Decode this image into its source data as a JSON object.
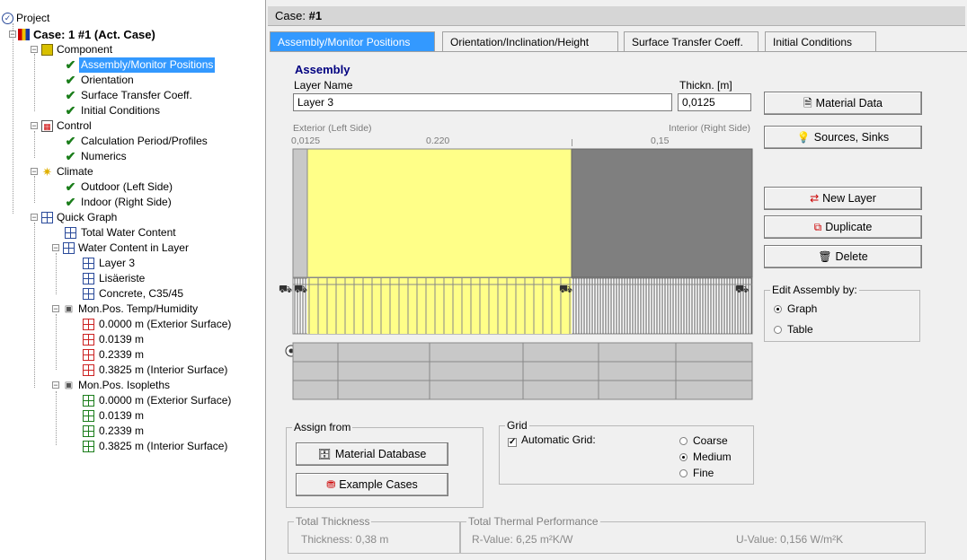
{
  "tree": {
    "project": "Project",
    "case": "Case: 1 #1 (Act. Case)",
    "component": "Component",
    "assembly": "Assembly/Monitor Positions",
    "orientation": "Orientation",
    "surface": "Surface Transfer Coeff.",
    "initial": "Initial Conditions",
    "control": "Control",
    "calc_period": "Calculation Period/Profiles",
    "numerics": "Numerics",
    "climate": "Climate",
    "outdoor": "Outdoor (Left Side)",
    "indoor": "Indoor (Right Side)",
    "quick_graph": "Quick Graph",
    "total_water": "Total Water Content",
    "water_layer": "Water Content in Layer",
    "layers": [
      "Layer 3",
      "Lisäeriste",
      "Concrete, C35/45"
    ],
    "mon_temp": "Mon.Pos. Temp/Humidity",
    "temp_items": [
      "0.0000 m (Exterior Surface)",
      "0.0139 m",
      "0.2339 m",
      "0.3825 m (Interior Surface)"
    ],
    "mon_iso": "Mon.Pos. Isopleths",
    "iso_items": [
      "0.0000 m (Exterior Surface)",
      "0.0139 m",
      "0.2339 m",
      "0.3825 m (Interior Surface)"
    ]
  },
  "header": {
    "prefix": "Case:",
    "case_name": "#1"
  },
  "tabs": [
    "Assembly/Monitor Positions",
    "Orientation/Inclination/Height",
    "Surface Transfer Coeff.",
    "Initial Conditions"
  ],
  "assembly": {
    "section_title": "Assembly",
    "layer_name_label": "Layer Name",
    "layer_name_value": "Layer 3",
    "thickness_label": "Thickn. [m]",
    "thickness_value": "0,0125",
    "exterior_label": "Exterior (Left Side)",
    "interior_label": "Interior (Right Side)",
    "dim_labels": [
      "0,0125",
      "0.220",
      "0,15"
    ]
  },
  "buttons": {
    "material_data": "Material Data",
    "sources_sinks": "Sources, Sinks",
    "new_layer": "New Layer",
    "duplicate": "Duplicate",
    "delete": "Delete",
    "material_database": "Material Database",
    "example_cases": "Example Cases"
  },
  "edit_by": {
    "label": "Edit Assembly by:",
    "options": [
      "Graph",
      "Table"
    ],
    "selected": "Graph"
  },
  "assign_from": {
    "label": "Assign from"
  },
  "grid": {
    "label": "Grid",
    "automatic_label": "Automatic Grid:",
    "automatic_checked": true,
    "options": [
      "Coarse",
      "Medium",
      "Fine"
    ],
    "selected": "Medium"
  },
  "totals": {
    "thickness_group": "Total Thickness",
    "thickness_text": "Thickness: 0,38 m",
    "performance_group": "Total Thermal Performance",
    "r_value": "R-Value: 6,25 m²K/W",
    "u_value": "U-Value: 0,156 W/m²K"
  },
  "colors": {
    "layer_yellow": "#ffff88",
    "concrete_gray": "#7f7f7f",
    "selected_blue": "#3399ff",
    "header_navy": "#000080"
  }
}
